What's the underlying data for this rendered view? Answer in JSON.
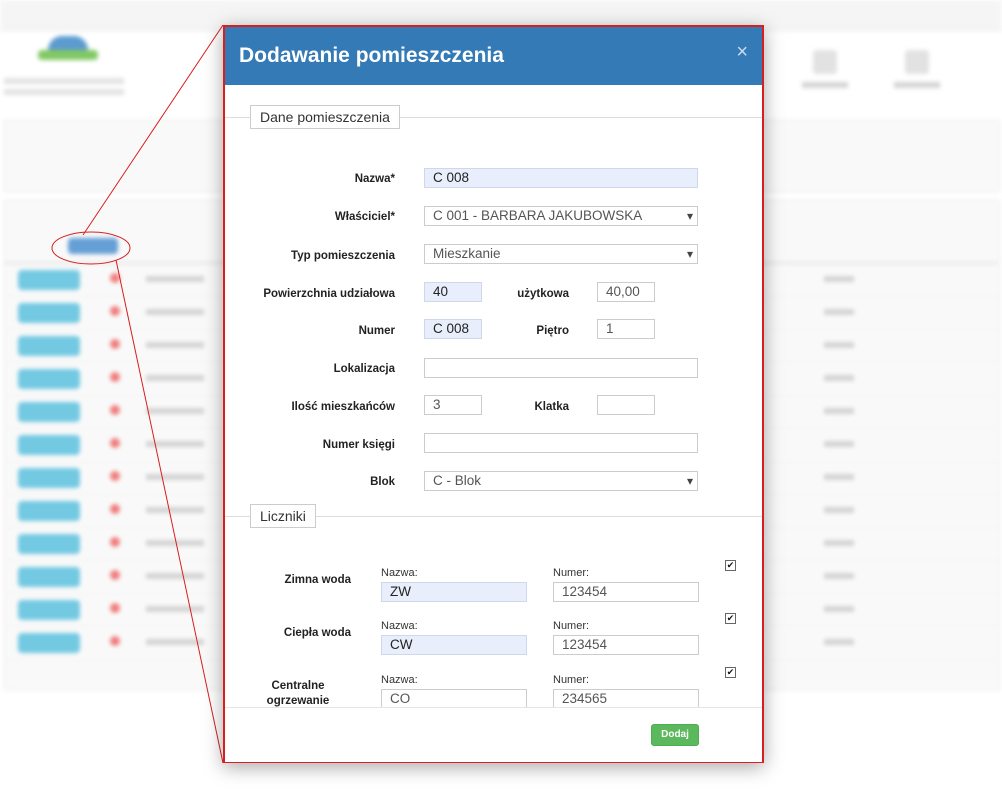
{
  "modal": {
    "title": "Dodawanie pomieszczenia",
    "close_label": "×"
  },
  "room_section": {
    "legend": "Dane pomieszczenia",
    "name_label": "Nazwa*",
    "name_value": "C 008",
    "owner_label": "Właściciel*",
    "owner_value": "C 001 - BARBARA JAKUBOWSKA",
    "type_label": "Typ pomieszczenia",
    "type_value": "Mieszkanie",
    "share_area_label": "Powierzchnia udziałowa",
    "share_area_value": "40",
    "usable_label": "użytkowa",
    "usable_value": "40,00",
    "number_label": "Numer",
    "number_value": "C 008",
    "floor_label": "Piętro",
    "floor_value": "1",
    "location_label": "Lokalizacja",
    "location_value": "",
    "residents_label": "Ilość mieszkańców",
    "residents_value": "3",
    "staircase_label": "Klatka",
    "staircase_value": "",
    "book_label": "Numer księgi",
    "book_value": "",
    "block_label": "Blok",
    "block_value": "C - Blok"
  },
  "meters_section": {
    "legend": "Liczniki",
    "name_sub": "Nazwa:",
    "number_sub": "Numer:",
    "meters": [
      {
        "label": "Zimna woda",
        "name": "ZW",
        "number": "123454",
        "checked": true
      },
      {
        "label": "Ciepła woda",
        "name": "CW",
        "number": "123454",
        "checked": true
      },
      {
        "label_line1": "Centralne",
        "label_line2": "ogrzewanie",
        "name": "CO",
        "number": "234565",
        "checked": true
      }
    ]
  },
  "footer": {
    "add_label": "Dodaj"
  },
  "colors": {
    "header": "#337ab7",
    "add_button": "#5cb85c",
    "callout": "#d91e1e",
    "highlight_input": "#e8eefb"
  }
}
